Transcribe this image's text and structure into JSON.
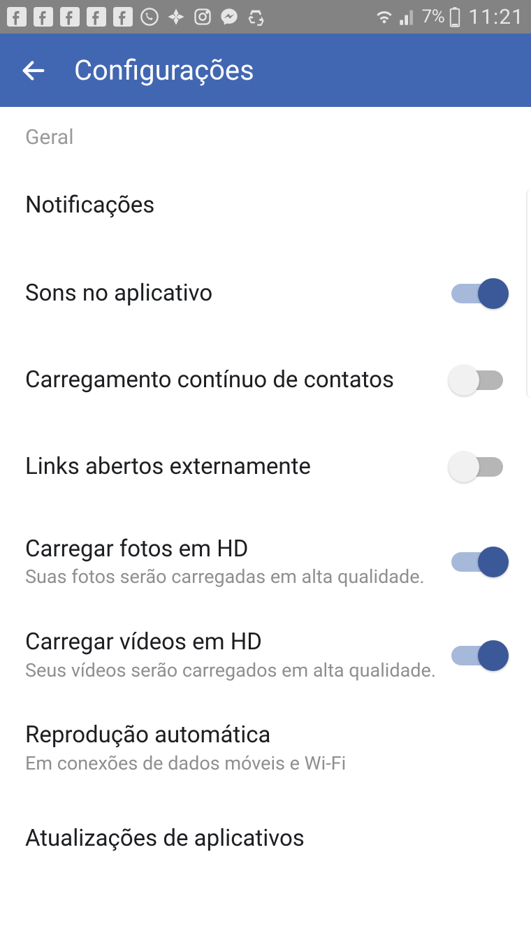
{
  "status": {
    "battery_text": "7%",
    "clock": "11:21"
  },
  "header": {
    "title": "Configurações"
  },
  "section": {
    "label": "Geral"
  },
  "settings": {
    "notifications": {
      "title": "Notificações"
    },
    "sounds": {
      "title": "Sons no aplicativo",
      "on": true
    },
    "contacts_upload": {
      "title": "Carregamento contínuo de contatos",
      "on": false
    },
    "external_links": {
      "title": "Links abertos externamente",
      "on": false
    },
    "photos_hd": {
      "title": "Carregar fotos em HD",
      "sub": "Suas fotos serão carregadas em alta qualidade.",
      "on": true
    },
    "videos_hd": {
      "title": "Carregar vídeos em HD",
      "sub": "Seus vídeos serão carregados em alta qualidade.",
      "on": true
    },
    "autoplay": {
      "title": "Reprodução automática",
      "sub": "Em conexões de dados móveis e Wi-Fi"
    },
    "app_updates": {
      "title": "Atualizações de aplicativos"
    }
  }
}
